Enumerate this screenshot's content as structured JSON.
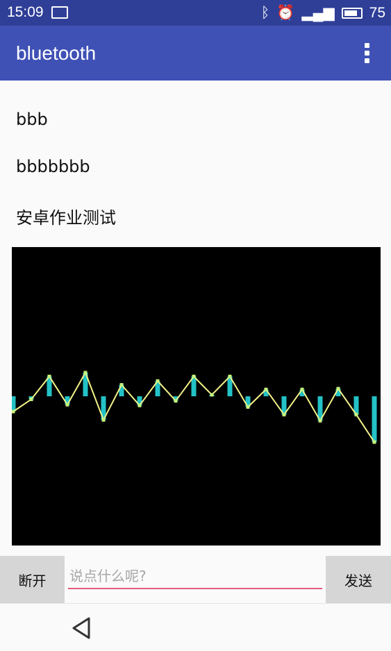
{
  "status": {
    "time": "15:09",
    "battery": "75",
    "icons": [
      "image-icon",
      "bluetooth-icon",
      "alarm-icon",
      "signal-icon",
      "battery-icon"
    ]
  },
  "appbar": {
    "title": "bluetooth",
    "overflow_icon": "more-vert-icon"
  },
  "messages": [
    "bbb",
    "bbbbbbb",
    "安卓作业测试"
  ],
  "chart_data": {
    "type": "line",
    "title": "",
    "xlabel": "",
    "ylabel": "",
    "x": [
      0,
      1,
      2,
      3,
      4,
      5,
      6,
      7,
      8,
      9,
      10,
      11,
      12,
      13,
      14,
      15,
      16,
      17,
      18,
      19,
      20
    ],
    "series": [
      {
        "color": "#f4f48a",
        "values": [
          -1.0,
          -0.2,
          1.3,
          -0.55,
          1.55,
          -1.55,
          0.75,
          -0.6,
          1.0,
          -0.3,
          1.3,
          0.1,
          1.3,
          -0.7,
          0.45,
          -1.2,
          0.45,
          -1.6,
          0.5,
          -1.2,
          -3.0
        ]
      }
    ],
    "bars_color": "#23c2c6",
    "ylim": [
      -8,
      8
    ],
    "grid": false
  },
  "bottom": {
    "disconnect_label": "断开",
    "input_placeholder": "说点什么呢?",
    "send_label": "发送"
  },
  "nav": {
    "back_icon": "back-triangle-icon"
  }
}
